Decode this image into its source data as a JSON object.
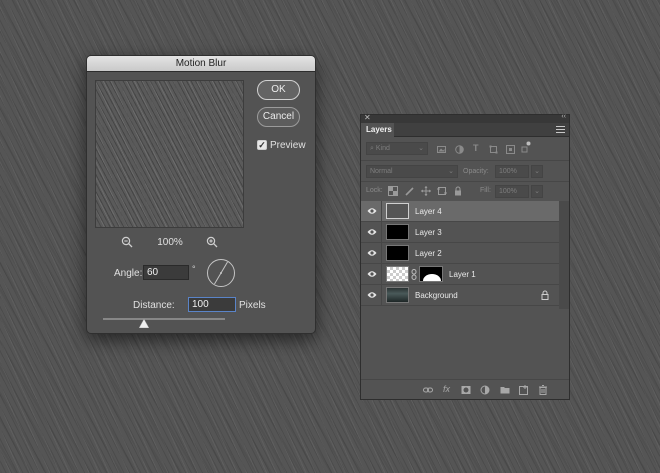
{
  "dialog": {
    "title": "Motion Blur",
    "ok_label": "OK",
    "cancel_label": "Cancel",
    "preview_label": "Preview",
    "preview_checked": true,
    "zoom_level": "100%",
    "angle_label": "Angle:",
    "angle_value": "60",
    "degree_symbol": "°",
    "distance_label": "Distance:",
    "distance_value": "100",
    "pixels_label": "Pixels"
  },
  "layers_panel": {
    "tab_label": "Layers",
    "kind_filter": "Kind",
    "blend_mode": "Normal",
    "opacity_label": "Opacity:",
    "opacity_value": "100%",
    "lock_label": "Lock:",
    "fill_label": "Fill:",
    "fill_value": "100%",
    "layers": [
      {
        "name": "Layer 4",
        "selected": true
      },
      {
        "name": "Layer 3",
        "selected": false
      },
      {
        "name": "Layer 2",
        "selected": false
      },
      {
        "name": "Layer 1",
        "selected": false,
        "has_mask": true
      },
      {
        "name": "Background",
        "selected": false,
        "locked": true
      }
    ]
  }
}
